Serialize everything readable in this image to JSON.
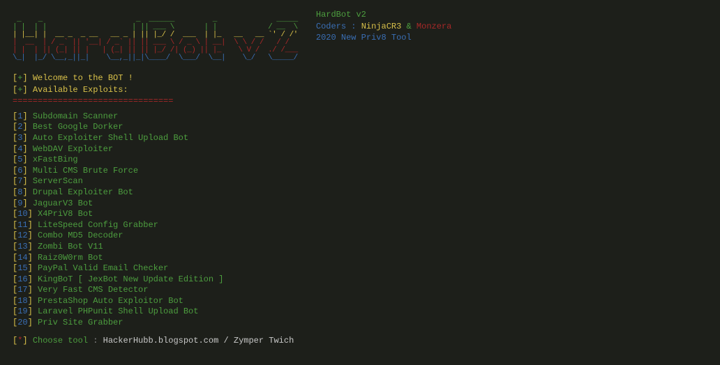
{
  "ascii": {
    "l1": " _    _                      _  ______         _              _____ ",
    "l2": "| |  | |                    | || ___ \\       | |            / __  \\",
    "l3": "| |__| |  __ _  _ __   __ _ | || |_/ /  ___  | |_   __   __ `' / /'",
    "l4": "|  __  | / _` || '__| / _` || || ___ \\ / _ \\ | __|  \\ \\ / /   / /  ",
    "l5": "| |  | || (_| || |   | (_| || || |_/ /| (_) || |_    \\ V /  ./ /___",
    "l6": "\\_|  |_/ \\__,_||_|    \\__,_||_|\\____/  \\___/  \\__|    \\_/   \\_____/"
  },
  "info": {
    "title": "HardBot v2",
    "coders_label": "Coders",
    "coder1": "NinjaCR3",
    "amp": "&",
    "coder2": "Monzera",
    "tagline": "2020 New Priv8 Tool"
  },
  "welcome_plus": "+",
  "welcome_text": "Welcome to the BOT !",
  "avail_plus": "+",
  "avail_text": "Available Exploits:",
  "divider": "================================",
  "menu": [
    {
      "n": "1",
      "label": "Subdomain Scanner"
    },
    {
      "n": "2",
      "label": "Best Google Dorker"
    },
    {
      "n": "3",
      "label": "Auto Exploiter Shell Upload Bot"
    },
    {
      "n": "4",
      "label": "WebDAV Exploiter"
    },
    {
      "n": "5",
      "label": "xFastBing"
    },
    {
      "n": "6",
      "label": "Multi CMS Brute Force"
    },
    {
      "n": "7",
      "label": "ServerScan"
    },
    {
      "n": "8",
      "label": "Drupal Exploiter Bot"
    },
    {
      "n": "9",
      "label": "JaguarV3 Bot"
    },
    {
      "n": "10",
      "label": "X4PriV8 Bot"
    },
    {
      "n": "11",
      "label": "LiteSpeed Config Grabber"
    },
    {
      "n": "12",
      "label": "Combo MD5 Decoder"
    },
    {
      "n": "13",
      "label": "Zombi Bot V11"
    },
    {
      "n": "14",
      "label": "Raiz0W0rm Bot"
    },
    {
      "n": "15",
      "label": "PayPal Valid Email Checker"
    },
    {
      "n": "16",
      "label": "KingBoT [ JexBot New Update Edition ]"
    },
    {
      "n": "17",
      "label": "Very Fast CMS Detector"
    },
    {
      "n": "18",
      "label": "PrestaShop Auto Exploitor Bot"
    },
    {
      "n": "19",
      "label": "Laravel PHPunit Shell Upload Bot"
    },
    {
      "n": "20",
      "label": "Priv Site Grabber"
    }
  ],
  "prompt": {
    "star": "*",
    "label": "Choose tool",
    "value": "HackerHubb.blogspot.com / Zymper Twich"
  },
  "brackets": {
    "open": "[",
    "close": "]"
  }
}
